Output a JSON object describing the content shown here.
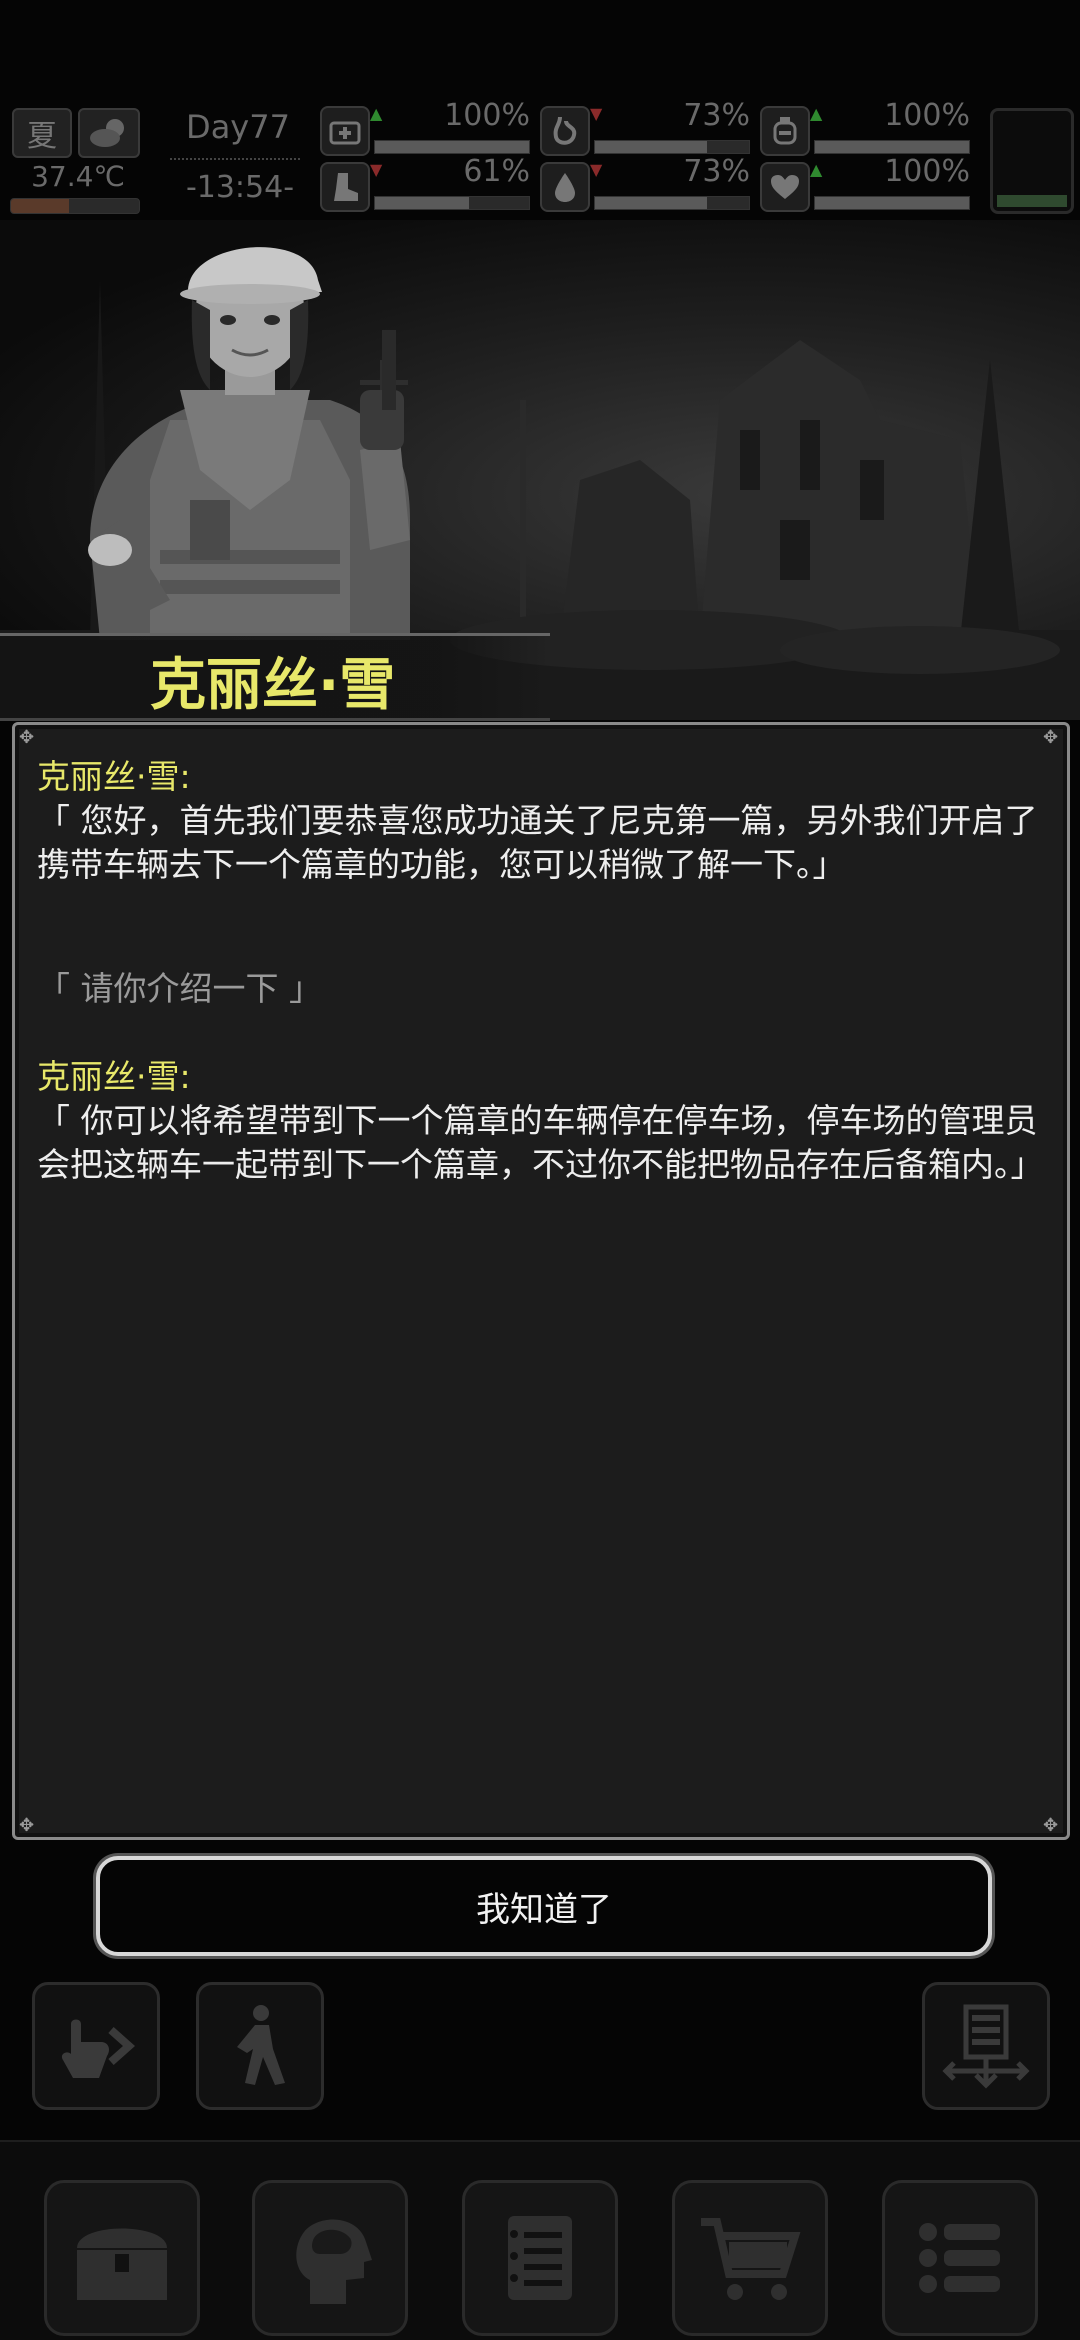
{
  "hud": {
    "season": "夏",
    "weather_icon": "cloudy-moon-icon",
    "temperature": "37.4℃",
    "temperature_level": 0.45,
    "day": "Day77",
    "time": "-13:54-",
    "stats": [
      {
        "icon": "medkit-icon",
        "trend": "up",
        "value": "100%",
        "level": 1.0
      },
      {
        "icon": "stomach-icon",
        "trend": "down",
        "value": "73%",
        "level": 0.73
      },
      {
        "icon": "bladder-icon",
        "trend": "up",
        "value": "100%",
        "level": 1.0
      },
      {
        "icon": "boot-icon",
        "trend": "down",
        "value": "61%",
        "level": 0.61
      },
      {
        "icon": "water-drop-icon",
        "trend": "down",
        "value": "73%",
        "level": 0.73
      },
      {
        "icon": "heart-icon",
        "trend": "up",
        "value": "100%",
        "level": 1.0
      }
    ]
  },
  "character": {
    "name": "克丽丝·雪"
  },
  "dialog": {
    "entry1_speaker": "克丽丝·雪:",
    "entry1_text": "「 您好，首先我们要恭喜您成功通关了尼克第一篇，另外我们开启了携带车辆去下一个篇章的功能，您可以稍微了解一下。」",
    "reply": "「 请你介绍一下 」",
    "entry2_speaker": "克丽丝·雪:",
    "entry2_text": "「 你可以将希望带到下一个篇章的车辆停在停车场，停车场的管理员会把这辆车一起带到下一个篇章，不过你不能把物品存在后备箱内。」"
  },
  "confirm_button": "我知道了",
  "colors": {
    "speaker": "#e8e86a",
    "trend_up": "#2f8a2f",
    "trend_down": "#8a2a2a"
  }
}
